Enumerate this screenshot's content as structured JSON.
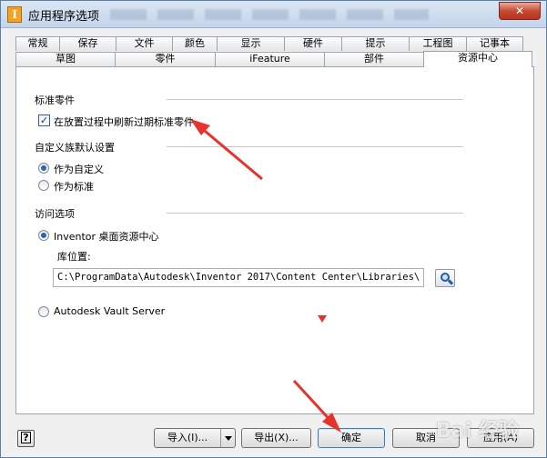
{
  "window": {
    "title": "应用程序选项",
    "icon_letter": "I",
    "close_label": "✕"
  },
  "tabs_top": [
    "常规",
    "保存",
    "文件",
    "颜色",
    "显示",
    "硬件",
    "提示",
    "工程图",
    "记事本"
  ],
  "tabs_bottom": [
    "草图",
    "零件",
    "iFeature",
    "部件",
    "资源中心"
  ],
  "active_tab": "资源中心",
  "sections": {
    "standard_parts": {
      "heading": "标准零件",
      "refresh_checkbox": {
        "label": "在放置过程中刷新过期标准零件",
        "checked": true
      }
    },
    "custom_family": {
      "heading": "自定义族默认设置",
      "options": [
        {
          "label": "作为自定义",
          "checked": true
        },
        {
          "label": "作为标准",
          "checked": false
        }
      ]
    },
    "access": {
      "heading": "访问选项",
      "inventor_option": {
        "label": "Inventor 桌面资源中心",
        "checked": true
      },
      "library_label": "库位置:",
      "library_path": "C:\\ProgramData\\Autodesk\\Inventor 2017\\Content Center\\Libraries\\",
      "vault_option": {
        "label": "Autodesk Vault Server",
        "checked": false
      }
    }
  },
  "footer": {
    "help_label": "?",
    "import_label": "导入(I)...",
    "export_label": "导出(X)...",
    "ok_label": "确定",
    "cancel_label": "取消",
    "apply_label": "应用(A)"
  },
  "annotation_color": "#e8322d",
  "watermark": "Bai 经验"
}
